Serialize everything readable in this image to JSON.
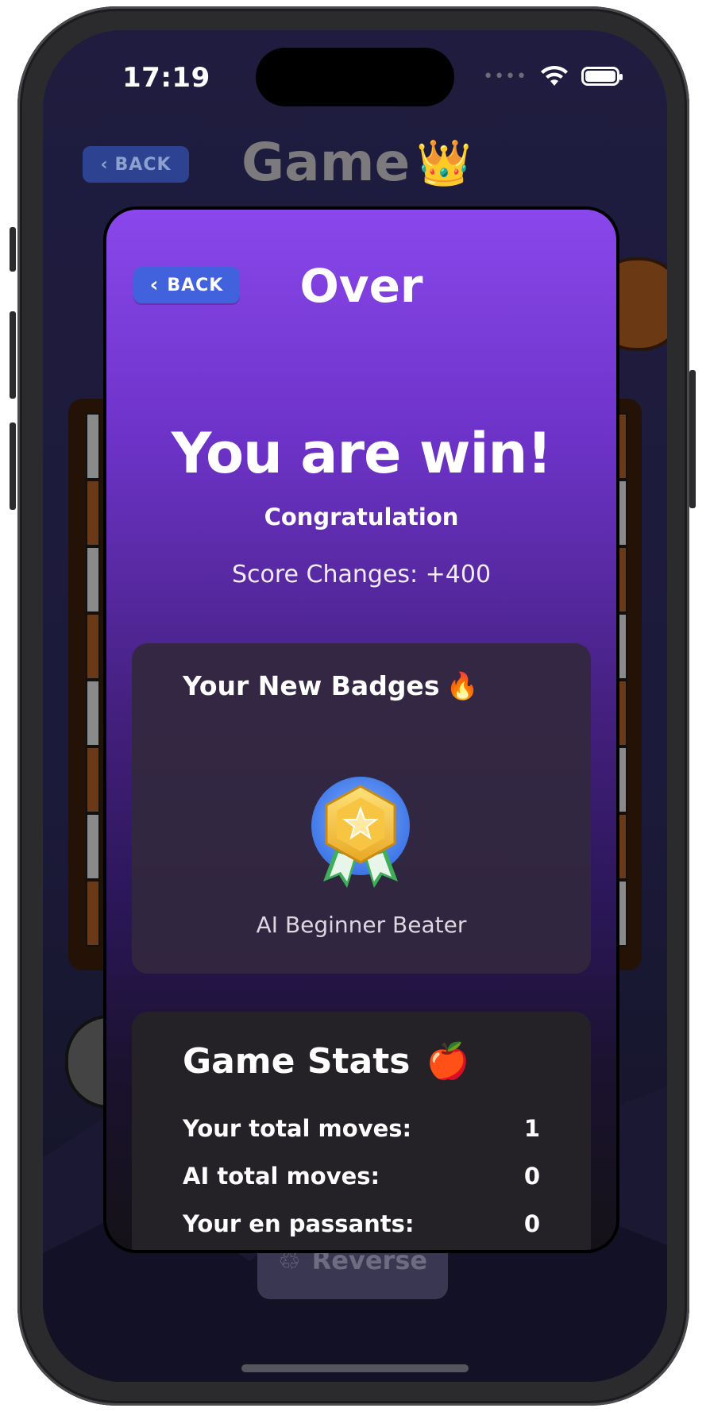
{
  "status_bar": {
    "time": "17:19"
  },
  "background": {
    "back_label": "BACK",
    "title": "Game",
    "crown_emoji": "👑",
    "reverse_label": "Reverse",
    "reverse_icon": "♲"
  },
  "modal": {
    "back_label": "BACK",
    "title": "Over",
    "headline": "You are win!",
    "subheadline": "Congratulation",
    "score_changes": "Score Changes: +400"
  },
  "badges": {
    "title": "Your New Badges",
    "emoji": "🔥",
    "items": [
      {
        "name": "AI Beginner Beater",
        "icon": "star-medal-icon"
      }
    ]
  },
  "stats": {
    "title": "Game Stats",
    "emoji": "🍎",
    "rows": [
      {
        "label": "Your total moves:",
        "value": "1"
      },
      {
        "label": "AI total moves:",
        "value": "0"
      },
      {
        "label": "Your en passants:",
        "value": "0"
      }
    ]
  },
  "colors": {
    "modal_top": "#8a47ec",
    "back_button": "#4261dc",
    "card_bg": "#242226"
  }
}
